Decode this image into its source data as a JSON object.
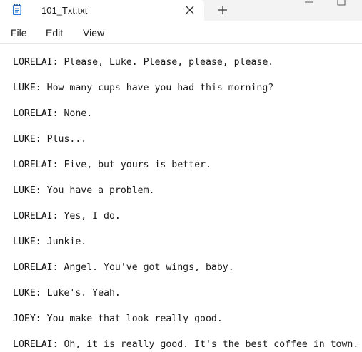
{
  "tab": {
    "title": "101_Txt.txt",
    "close_icon": "close-icon",
    "new_tab_icon": "plus-icon",
    "app_icon": "notepad-icon"
  },
  "window_controls": {
    "minimize_icon": "minimize-icon",
    "maximize_icon": "maximize-icon"
  },
  "menu": {
    "file": "File",
    "edit": "Edit",
    "view": "View"
  },
  "document": {
    "lines": [
      "LORELAI: Please, Luke. Please, please, please.",
      "LUKE: How many cups have you had this morning?",
      "LORELAI: None.",
      "LUKE: Plus...",
      "LORELAI: Five, but yours is better.",
      "LUKE: You have a problem.",
      "LORELAI: Yes, I do.",
      "LUKE: Junkie.",
      "LORELAI: Angel. You've got wings, baby.",
      "LUKE: Luke's. Yeah.",
      "JOEY: You make that look really good.",
      "LORELAI: Oh, it is really good. It's the best coffee in town."
    ]
  },
  "colors": {
    "titlebar": "#f3f3f3",
    "accent": "#2a78d6",
    "text": "#1a1a1a"
  }
}
